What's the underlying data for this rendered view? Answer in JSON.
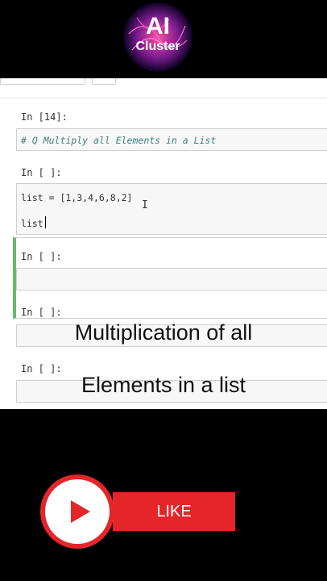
{
  "branding": {
    "logo_text_line1": "AI",
    "logo_text_line2": "Cluster"
  },
  "cells": [
    {
      "prompt": "In [14]:",
      "source": "# Q Multiply all Elements in a List"
    },
    {
      "prompt": "In [ ]:",
      "source_line1": "list = [1,3,4,6,8,2]",
      "source_line2": "list"
    },
    {
      "prompt": "In [ ]:"
    },
    {
      "prompt": "In [ ]:"
    },
    {
      "prompt": "In [ ]:"
    }
  ],
  "overlay": {
    "caption_line1": "Multiplication of all",
    "caption_line2": "Elements in  a list"
  },
  "cta": {
    "like_label": "LIKE"
  },
  "colors": {
    "like_red": "#e4262b",
    "selected_cell_border": "#66bb6a",
    "comment": "#408080"
  }
}
